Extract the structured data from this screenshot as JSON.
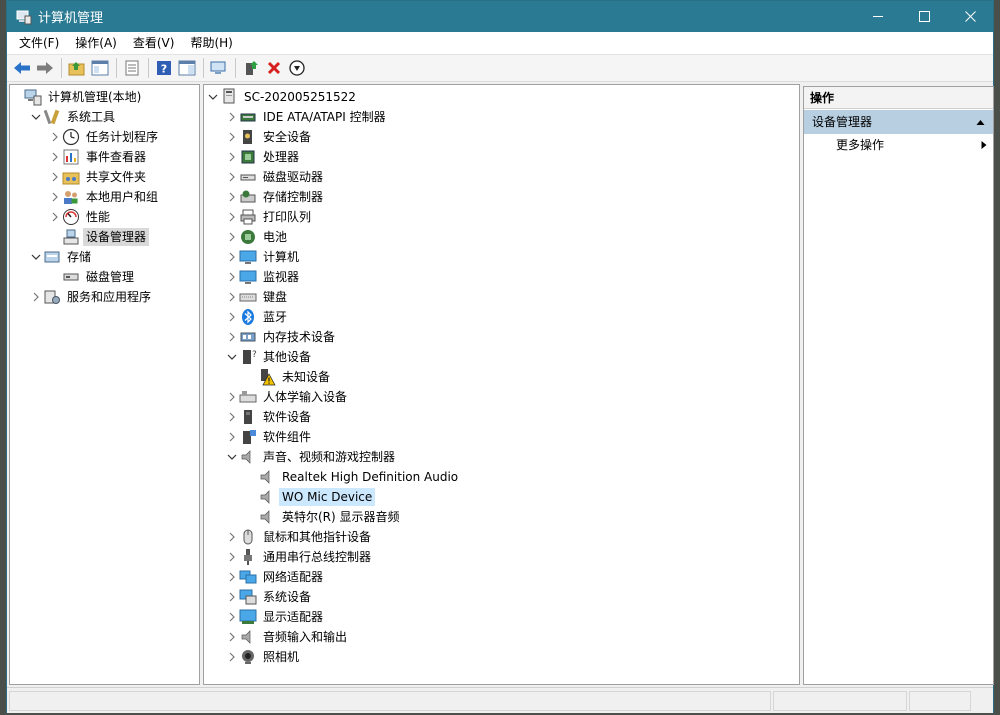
{
  "window": {
    "title": "计算机管理",
    "controls": [
      "minimize-icon",
      "maximize-icon",
      "close-icon"
    ]
  },
  "menu": [
    "文件(F)",
    "操作(A)",
    "查看(V)",
    "帮助(H)"
  ],
  "toolbar": [
    "back-arrow-icon",
    "forward-arrow-icon",
    "sep",
    "up-folder-icon",
    "show-tree-icon",
    "sep",
    "properties-icon",
    "sep",
    "help-icon",
    "action-pane-icon",
    "sep",
    "scan-hardware-icon",
    "sep",
    "update-driver-icon",
    "uninstall-icon",
    "disable-icon"
  ],
  "left_tree": [
    {
      "label": "计算机管理(本地)",
      "level": 0,
      "chevron": "",
      "icon": "computer-mgmt-icon"
    },
    {
      "label": "系统工具",
      "level": 1,
      "chevron": "down",
      "icon": "tools-icon"
    },
    {
      "label": "任务计划程序",
      "level": 2,
      "chevron": "right",
      "icon": "clock-icon"
    },
    {
      "label": "事件查看器",
      "level": 2,
      "chevron": "right",
      "icon": "event-viewer-icon"
    },
    {
      "label": "共享文件夹",
      "level": 2,
      "chevron": "right",
      "icon": "shared-folder-icon"
    },
    {
      "label": "本地用户和组",
      "level": 2,
      "chevron": "right",
      "icon": "users-icon"
    },
    {
      "label": "性能",
      "level": 2,
      "chevron": "right",
      "icon": "performance-icon"
    },
    {
      "label": "设备管理器",
      "level": 2,
      "chevron": "",
      "icon": "device-manager-icon",
      "selected": true
    },
    {
      "label": "存储",
      "level": 1,
      "chevron": "down",
      "icon": "storage-icon"
    },
    {
      "label": "磁盘管理",
      "level": 2,
      "chevron": "",
      "icon": "disk-icon"
    },
    {
      "label": "服务和应用程序",
      "level": 1,
      "chevron": "right",
      "icon": "services-icon"
    }
  ],
  "device_tree": [
    {
      "label": "SC-202005251522",
      "level": 0,
      "chevron": "down",
      "icon": "computer-icon"
    },
    {
      "label": "IDE ATA/ATAPI 控制器",
      "level": 1,
      "chevron": "right",
      "icon": "ide-controller-icon"
    },
    {
      "label": "安全设备",
      "level": 1,
      "chevron": "right",
      "icon": "security-device-icon"
    },
    {
      "label": "处理器",
      "level": 1,
      "chevron": "right",
      "icon": "processor-icon"
    },
    {
      "label": "磁盘驱动器",
      "level": 1,
      "chevron": "right",
      "icon": "disk-drive-icon"
    },
    {
      "label": "存储控制器",
      "level": 1,
      "chevron": "right",
      "icon": "storage-controller-icon"
    },
    {
      "label": "打印队列",
      "level": 1,
      "chevron": "right",
      "icon": "printer-icon"
    },
    {
      "label": "电池",
      "level": 1,
      "chevron": "right",
      "icon": "battery-icon"
    },
    {
      "label": "计算机",
      "level": 1,
      "chevron": "right",
      "icon": "monitor-icon"
    },
    {
      "label": "监视器",
      "level": 1,
      "chevron": "right",
      "icon": "monitor-icon"
    },
    {
      "label": "键盘",
      "level": 1,
      "chevron": "right",
      "icon": "keyboard-icon"
    },
    {
      "label": "蓝牙",
      "level": 1,
      "chevron": "right",
      "icon": "bluetooth-icon"
    },
    {
      "label": "内存技术设备",
      "level": 1,
      "chevron": "right",
      "icon": "memory-device-icon"
    },
    {
      "label": "其他设备",
      "level": 1,
      "chevron": "down",
      "icon": "other-devices-icon"
    },
    {
      "label": "未知设备",
      "level": 2,
      "chevron": "",
      "icon": "unknown-device-warning-icon"
    },
    {
      "label": "人体学输入设备",
      "level": 1,
      "chevron": "right",
      "icon": "hid-icon"
    },
    {
      "label": "软件设备",
      "level": 1,
      "chevron": "right",
      "icon": "software-device-icon"
    },
    {
      "label": "软件组件",
      "level": 1,
      "chevron": "right",
      "icon": "software-component-icon"
    },
    {
      "label": "声音、视频和游戏控制器",
      "level": 1,
      "chevron": "down",
      "icon": "speaker-icon"
    },
    {
      "label": "Realtek High Definition Audio",
      "level": 2,
      "chevron": "",
      "icon": "speaker-icon"
    },
    {
      "label": "WO Mic Device",
      "level": 2,
      "chevron": "",
      "icon": "speaker-icon",
      "selected": true
    },
    {
      "label": "英特尔(R) 显示器音频",
      "level": 2,
      "chevron": "",
      "icon": "speaker-icon"
    },
    {
      "label": "鼠标和其他指针设备",
      "level": 1,
      "chevron": "right",
      "icon": "mouse-icon"
    },
    {
      "label": "通用串行总线控制器",
      "level": 1,
      "chevron": "right",
      "icon": "usb-icon"
    },
    {
      "label": "网络适配器",
      "level": 1,
      "chevron": "right",
      "icon": "network-adapter-icon"
    },
    {
      "label": "系统设备",
      "level": 1,
      "chevron": "right",
      "icon": "system-device-icon"
    },
    {
      "label": "显示适配器",
      "level": 1,
      "chevron": "right",
      "icon": "display-adapter-icon"
    },
    {
      "label": "音频输入和输出",
      "level": 1,
      "chevron": "right",
      "icon": "speaker-icon"
    },
    {
      "label": "照相机",
      "level": 1,
      "chevron": "right",
      "icon": "camera-icon"
    }
  ],
  "actions": {
    "header": "操作",
    "section": "设备管理器",
    "more": "更多操作"
  }
}
